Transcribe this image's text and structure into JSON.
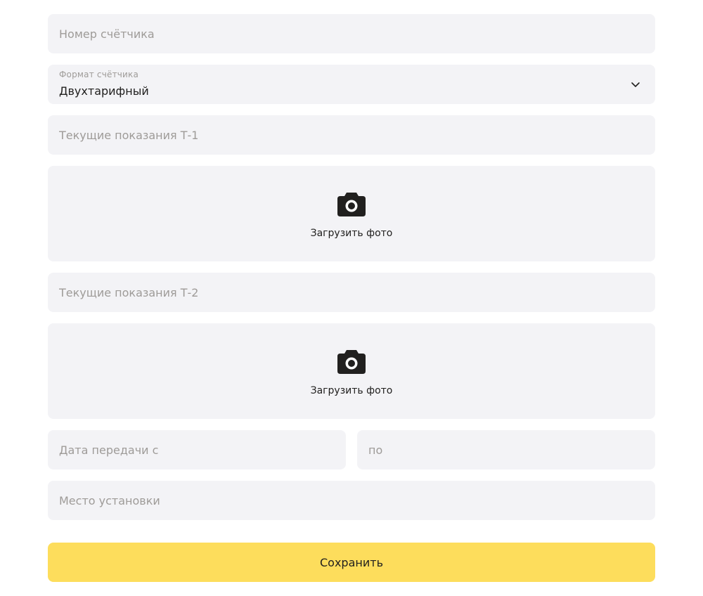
{
  "form": {
    "meter_number": {
      "placeholder": "Номер счётчика",
      "value": ""
    },
    "meter_format": {
      "label": "Формат счётчика",
      "value": "Двухтарифный"
    },
    "reading_t1": {
      "placeholder": "Текущие показания Т-1",
      "value": ""
    },
    "upload_t1": {
      "icon": "camera-icon",
      "label": "Загрузить фото"
    },
    "reading_t2": {
      "placeholder": "Текущие показания Т-2",
      "value": ""
    },
    "upload_t2": {
      "icon": "camera-icon",
      "label": "Загрузить фото"
    },
    "date_from": {
      "placeholder": "Дата передачи с",
      "value": ""
    },
    "date_to": {
      "placeholder": "по",
      "value": ""
    },
    "install_place": {
      "placeholder": "Место установки",
      "value": ""
    },
    "save_label": "Сохранить"
  },
  "colors": {
    "field_bg": "#f3f3f6",
    "placeholder": "#9e9b98",
    "text": "#21201f",
    "accent": "#fddd5c"
  }
}
